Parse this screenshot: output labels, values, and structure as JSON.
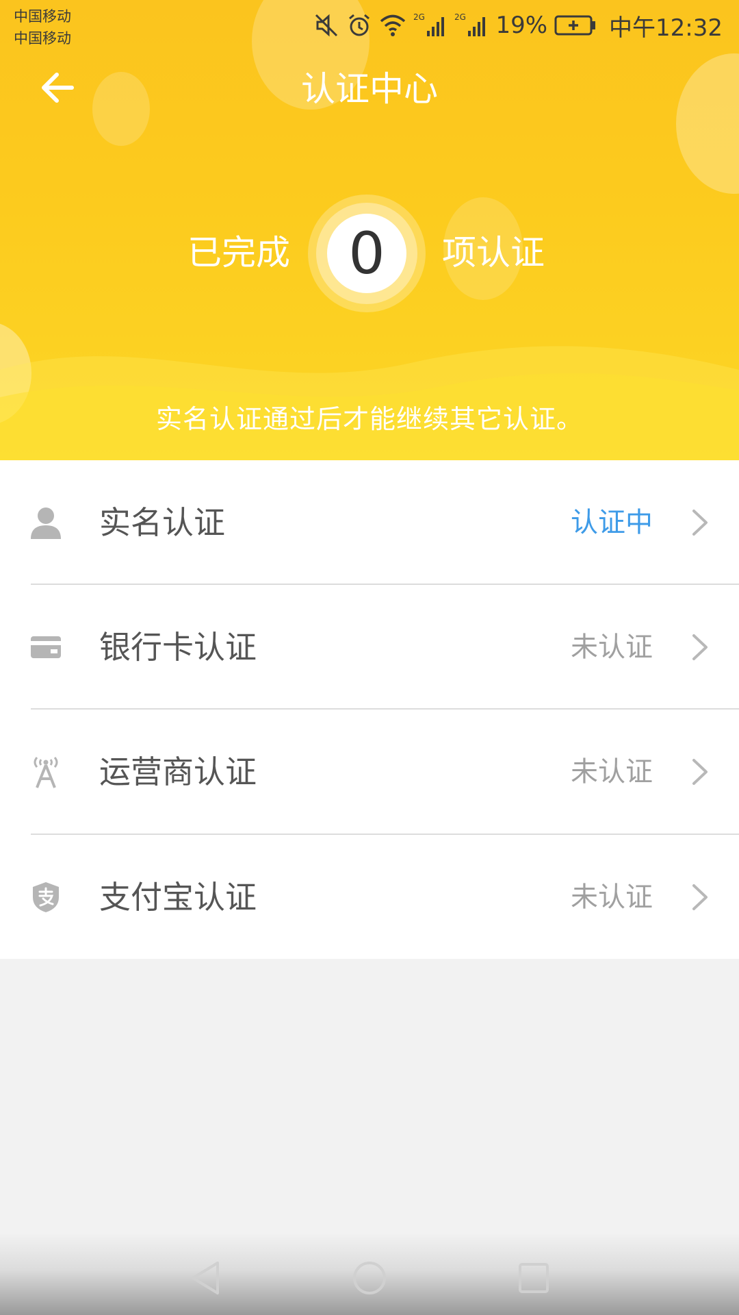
{
  "status_bar": {
    "carrier_1": "中国移动",
    "carrier_2": "中国移动",
    "network_1": "2G",
    "network_2": "2G",
    "battery_percent": "19%",
    "time": "中午12:32",
    "icons": [
      "mute-icon",
      "alarm-icon",
      "wifi-icon",
      "signal-icon",
      "signal-icon",
      "battery-charging-icon"
    ]
  },
  "header": {
    "title": "认证中心",
    "back_icon": "arrow-left-icon",
    "summary_prefix": "已完成",
    "completed_count": "0",
    "summary_suffix": "项认证",
    "notice": "实名认证通过后才能继续其它认证。"
  },
  "verifications": [
    {
      "icon": "person-icon",
      "label": "实名认证",
      "status": "认证中",
      "status_color": "#3e9be8"
    },
    {
      "icon": "bank-card-icon",
      "label": "银行卡认证",
      "status": "未认证",
      "status_color": "#a0a0a0"
    },
    {
      "icon": "cell-tower-icon",
      "label": "运营商认证",
      "status": "未认证",
      "status_color": "#a0a0a0"
    },
    {
      "icon": "alipay-shield-icon",
      "label": "支付宝认证",
      "status": "未认证",
      "status_color": "#a0a0a0"
    }
  ],
  "nav_bar": {
    "icons": [
      "nav-back-icon",
      "nav-home-icon",
      "nav-recent-icon"
    ]
  },
  "colors": {
    "header_yellow": "#fcc820",
    "status_active": "#3e9be8",
    "status_inactive": "#a0a0a0",
    "page_background": "#f2f2f2"
  }
}
